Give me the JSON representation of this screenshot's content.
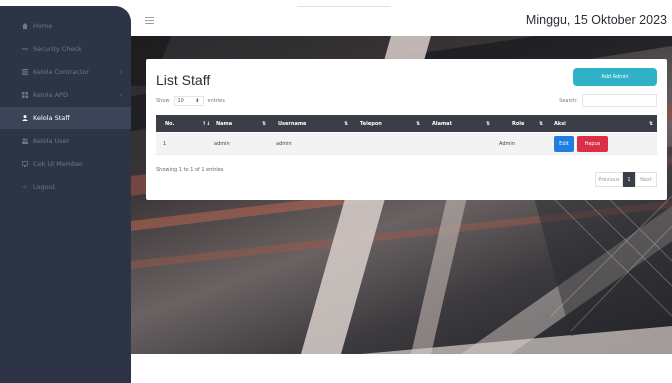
{
  "sidebar": {
    "items": [
      {
        "label": "Home",
        "icon": "home-icon",
        "active": false
      },
      {
        "label": "Security Check",
        "icon": "shield-icon",
        "active": false
      },
      {
        "label": "Kelola Contractor",
        "icon": "list-icon",
        "active": false,
        "chevron": "›"
      },
      {
        "label": "Kelola APD",
        "icon": "grid-icon",
        "active": false,
        "chevron": "›"
      },
      {
        "label": "Kelola Staff",
        "icon": "user-icon",
        "active": true
      },
      {
        "label": "Kelola User",
        "icon": "users-icon",
        "active": false
      },
      {
        "label": "Cek UI Member",
        "icon": "monitor-icon",
        "active": false
      },
      {
        "label": "Logout",
        "icon": "logout-icon",
        "active": false
      }
    ]
  },
  "header": {
    "date": "Minggu, 15 Oktober 2023"
  },
  "card": {
    "title": "List Staff",
    "add_button": "Add Admin",
    "show_label": "Show",
    "show_value": "10",
    "entries_label": "entries",
    "search_label": "Search:",
    "columns": [
      "No.",
      "Nama",
      "Username",
      "Telepon",
      "Alamat",
      "Role",
      "Aksi"
    ],
    "rows": [
      {
        "no": "1",
        "nama": "admin",
        "username": "admin",
        "telepon": "",
        "alamat": "",
        "role": "Admin",
        "edit": "Edit",
        "hapus": "Hapus"
      }
    ],
    "info": "Showing 1 to 1 of 1 entries",
    "pagination": {
      "previous": "Previous",
      "current": "1",
      "next": "Next"
    }
  },
  "colors": {
    "sidebar_bg": "#2c3445",
    "accent_add": "#2fb1c7",
    "edit": "#1e7ddf",
    "delete": "#dc2f45",
    "table_header": "#3a3e47"
  }
}
